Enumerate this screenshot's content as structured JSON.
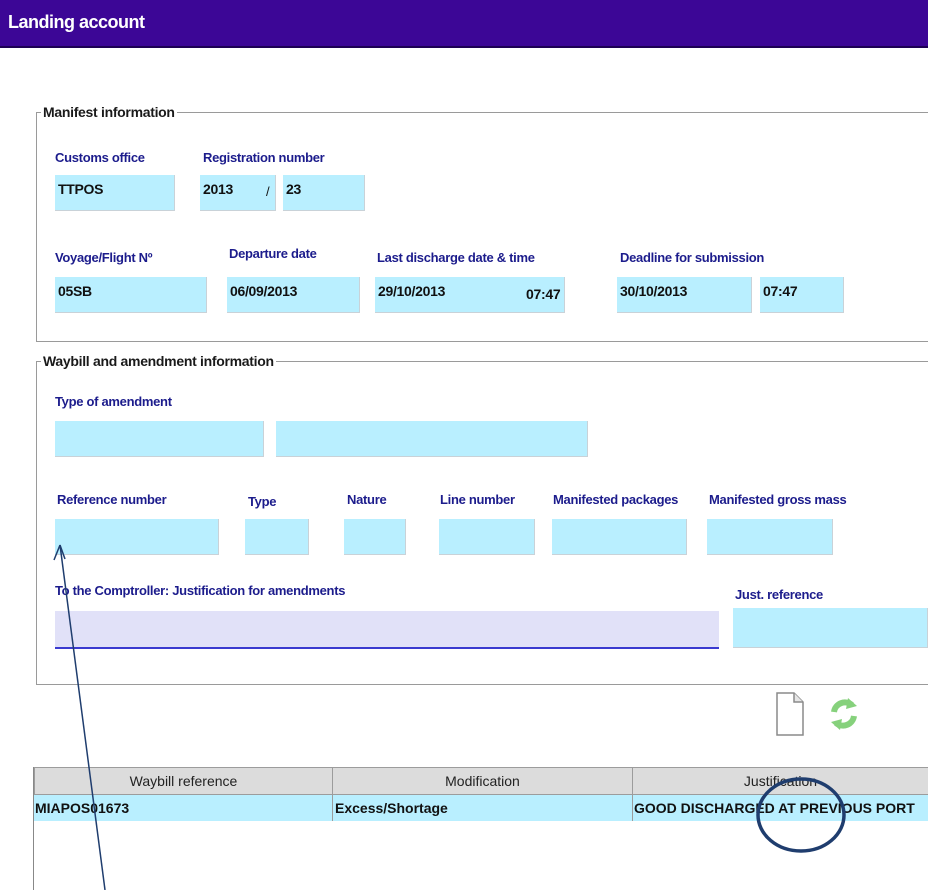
{
  "title": "Landing account",
  "manifest": {
    "legend": "Manifest information",
    "customs_office_label": "Customs office",
    "customs_office_value": "TTPOS",
    "registration_label": "Registration number",
    "registration_year": "2013",
    "registration_sep": "/",
    "registration_number": "23",
    "voyage_label": "Voyage/Flight Nº",
    "voyage_value": "05SB",
    "departure_label": "Departure date",
    "departure_value": "06/09/2013",
    "last_discharge_label": "Last discharge date & time",
    "last_discharge_date": "29/10/2013",
    "last_discharge_time": "07:47",
    "deadline_label": "Deadline for submission",
    "deadline_date": "30/10/2013",
    "deadline_time": "07:47"
  },
  "waybill": {
    "legend": "Waybill and amendment information",
    "type_of_amendment_label": "Type of amendment",
    "reference_number_label": "Reference number",
    "type_label": "Type",
    "nature_label": "Nature",
    "line_number_label": "Line number",
    "manifested_packages_label": "Manifested packages",
    "manifested_gross_mass_label": "Manifested gross mass",
    "justification_label": "To the Comptroller: Justification for amendments",
    "just_reference_label": "Just. reference"
  },
  "toolbar": {
    "new_icon": "new-document-icon",
    "refresh_icon": "refresh-icon"
  },
  "table": {
    "columns": [
      "Waybill reference",
      "Modification",
      "Justification"
    ],
    "rows": [
      [
        "MIAPOS01673",
        "Excess/Shortage",
        "GOOD DISCHARGED AT PREVIOUS PORT"
      ]
    ]
  },
  "colors": {
    "titlebar": "#3c0696",
    "field_bg": "#b9efff",
    "label": "#1c1c8c",
    "annotation": "#1f3d6e"
  }
}
